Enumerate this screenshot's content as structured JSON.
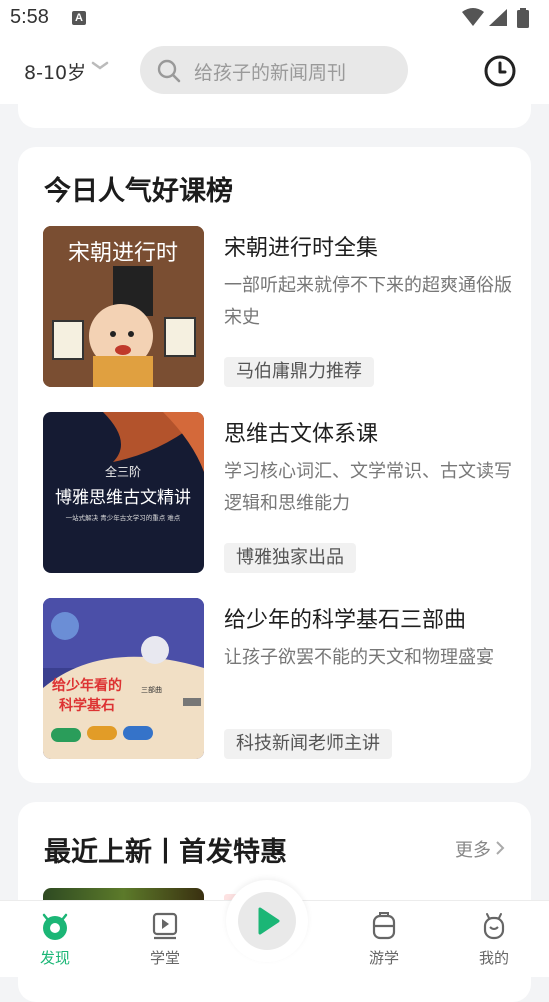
{
  "status_bar": {
    "time": "5:58",
    "notification_letter": "A"
  },
  "header": {
    "age_filter": "8-10岁",
    "search_placeholder": "给孩子的新闻周刊"
  },
  "popular_section": {
    "title": "今日人气好课榜",
    "items": [
      {
        "title": "宋朝进行时全集",
        "description": "一部听起来就停不下来的超爽通俗版宋史",
        "tag": "马伯庸鼎力推荐",
        "cover_text": "宋朝进行时"
      },
      {
        "title": "思维古文体系课",
        "description": "学习核心词汇、文学常识、古文读写逻辑和思维能力",
        "tag": "博雅独家出品",
        "cover_badge": "全三阶",
        "cover_text": "博雅思维古文精讲",
        "cover_sub": "一站式解决 青少年古文学习的重点 难点"
      },
      {
        "title": "给少年的科学基石三部曲",
        "description": "让孩子欲罢不能的天文和物理盛宴",
        "tag": "科技新闻老师主讲",
        "cover_text_line1": "给少年看的",
        "cover_text_line2": "科学基石",
        "cover_badge": "三部曲"
      }
    ]
  },
  "new_section": {
    "title": "最近上新丨首发特惠",
    "more_label": "更多"
  },
  "tabbar": {
    "tabs": [
      {
        "label": "发现"
      },
      {
        "label": "学堂"
      },
      {
        "label": "游学"
      },
      {
        "label": "我的"
      }
    ],
    "active_color": "#1bb676"
  }
}
